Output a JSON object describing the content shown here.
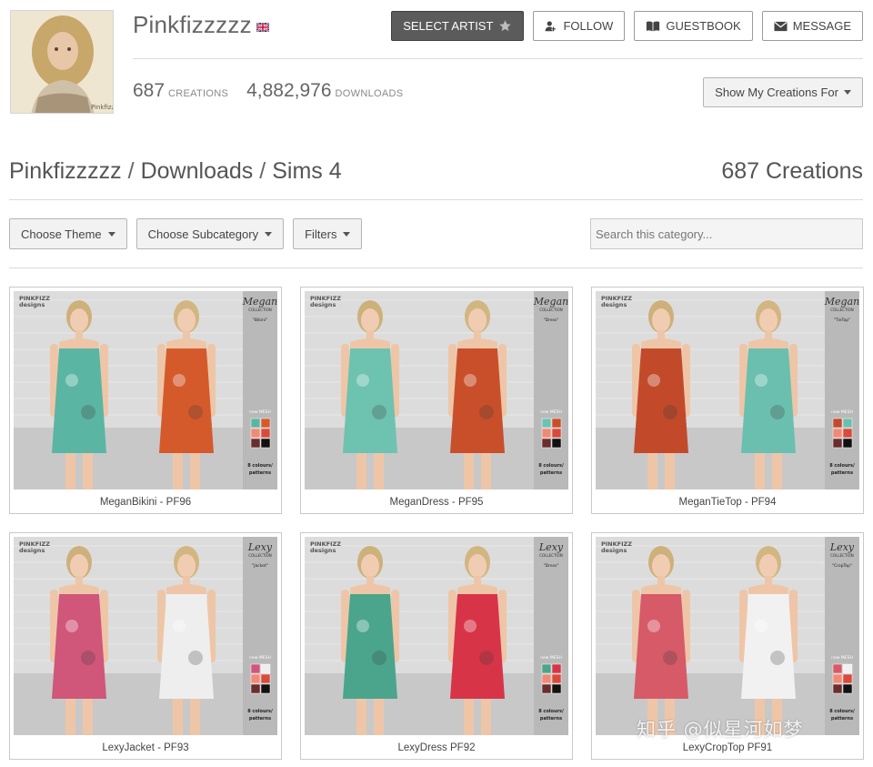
{
  "artist": {
    "name": "Pinkfizzzzz",
    "flag_icon": "uk-flag-icon"
  },
  "actions": {
    "select_artist": "SELECT ARTIST",
    "follow": "FOLLOW",
    "guestbook": "GUESTBOOK",
    "message": "MESSAGE"
  },
  "stats": {
    "creations_count": "687",
    "creations_label": "CREATIONS",
    "downloads_count": "4,882,976",
    "downloads_label": "DOWNLOADS"
  },
  "show_creations_button": "Show My Creations For",
  "breadcrumb": {
    "part1": "Pinkfizzzzz",
    "sep": "/",
    "part2": "Downloads",
    "part3": "Sims 4"
  },
  "creations_title": "687 Creations",
  "filters": {
    "theme": "Choose Theme",
    "subcategory": "Choose Subcategory",
    "filters": "Filters"
  },
  "search": {
    "placeholder": "Search this category..."
  },
  "items": [
    {
      "title": "MeganBikini - PF96",
      "collection": "Megan",
      "subtitle": "\"Bikini\""
    },
    {
      "title": "MeganDress - PF95",
      "collection": "Megan",
      "subtitle": "\"Dress\""
    },
    {
      "title": "MeganTieTop - PF94",
      "collection": "Megan",
      "subtitle": "\"TieTop\""
    },
    {
      "title": "LexyJacket - PF93",
      "collection": "Lexy",
      "subtitle": "\"Jacket\""
    },
    {
      "title": "LexyDress PF92",
      "collection": "Lexy",
      "subtitle": "\"Dress\""
    },
    {
      "title": "LexyCropTop PF91",
      "collection": "Lexy",
      "subtitle": "\"CropTop\""
    }
  ],
  "thumb_labels": {
    "brand_top": "PINKFIZZ",
    "brand_bottom": "designs",
    "collection_word": "COLLECTION",
    "new_mesh": "new MESH",
    "colours": "8 colours/",
    "patterns": "patterns",
    "avatar_caption": "Pinkfizz"
  },
  "colors": {
    "dark_button": "#5b5b5b",
    "border": "#c9c9c9",
    "text": "#555555"
  },
  "watermark": "知乎 @似星河如梦"
}
